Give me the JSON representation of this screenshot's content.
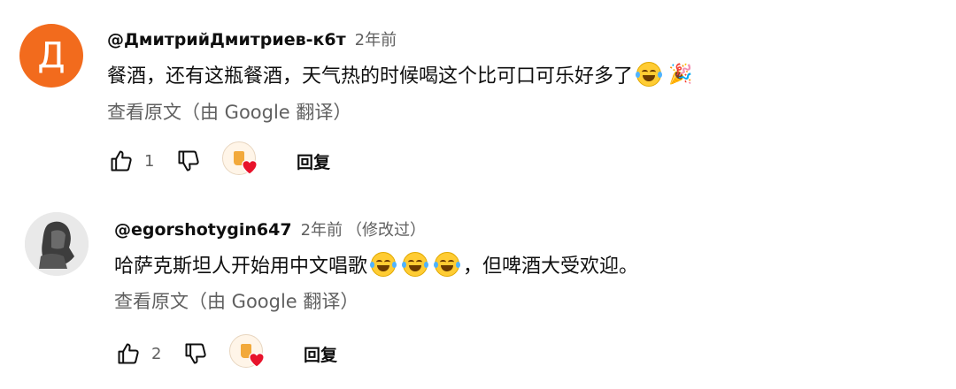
{
  "comments": [
    {
      "avatar_letter": "Д",
      "avatar_color": "#f26b1d",
      "author": "@ДмитрийДмитриев-к6т",
      "time": "2年前",
      "edited": "",
      "text": "餐酒，还有这瓶餐酒，天气热的时候喝这个比可口可乐好多了",
      "emojis": [
        "face-with-tears-of-joy",
        "party-popper"
      ],
      "translate_label": "查看原文（由 Google 翻译）",
      "like_count": "1",
      "reply_label": "回复"
    },
    {
      "avatar_letter": "",
      "avatar_color": "#e7e7e7",
      "author": "@egorshotygin647",
      "time": "2年前",
      "edited": "（修改过）",
      "text_before": "哈萨克斯坦人开始用中文唱歌",
      "text_after": "，但啤酒大受欢迎。",
      "emojis": [
        "face-with-tears-of-joy",
        "face-with-tears-of-joy",
        "face-with-tears-of-joy"
      ],
      "translate_label": "查看原文（由 Google 翻译）",
      "like_count": "2",
      "reply_label": "回复"
    }
  ],
  "colors": {
    "text": "#0f0f0f",
    "secondary": "#606060",
    "heart": "#e8132b"
  }
}
